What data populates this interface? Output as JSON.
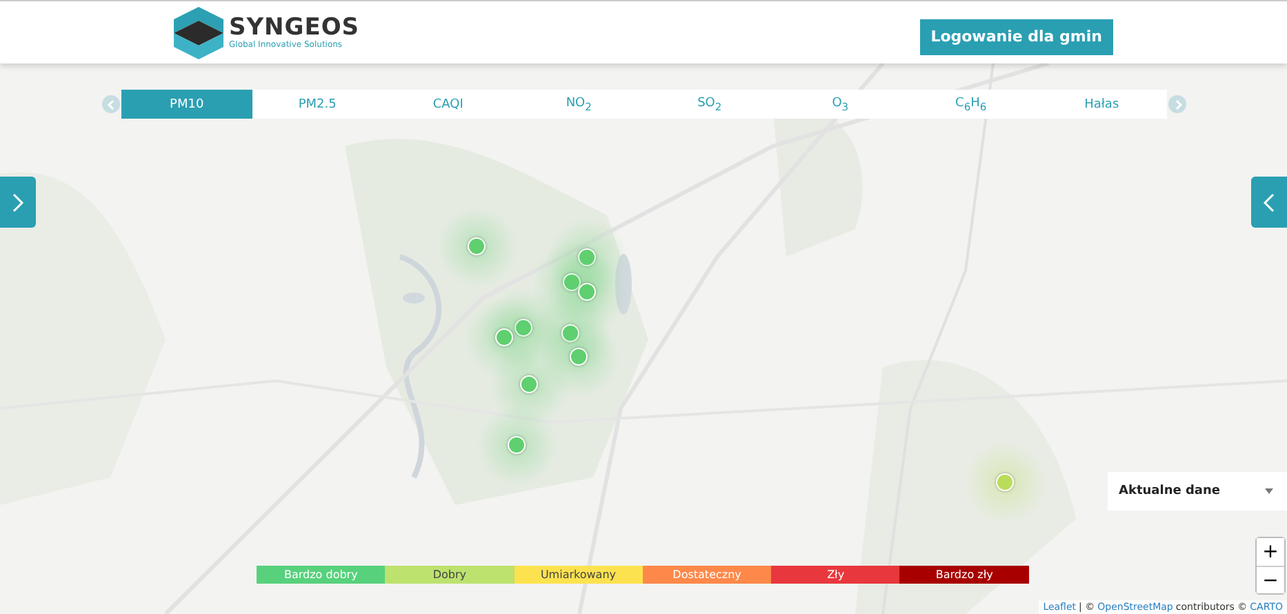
{
  "header": {
    "logo_name": "SYNGEOS",
    "logo_tagline": "Global Innovative Solutions",
    "login_button": "Logowanie dla gmin"
  },
  "tabs": [
    {
      "label": "PM10",
      "selected": true
    },
    {
      "label": "PM2.5",
      "selected": false
    },
    {
      "label": "CAQI",
      "selected": false
    },
    {
      "label": "NO$_{2}$",
      "selected": false
    },
    {
      "label": "SO$_{2}$",
      "selected": false
    },
    {
      "label": "O$_{3}$",
      "selected": false
    },
    {
      "label": "C$_{6}$H$_{6}$",
      "selected": false
    },
    {
      "label": "Hałas",
      "selected": false
    }
  ],
  "stations": [
    {
      "color": "#5fcf6f"
    },
    {
      "color": "#5fcf6f"
    },
    {
      "color": "#5fcf6f"
    },
    {
      "color": "#5fcf6f"
    },
    {
      "color": "#5fcf6f"
    },
    {
      "color": "#5fcf6f"
    },
    {
      "color": "#5fcf6f"
    },
    {
      "color": "#5fcf6f"
    },
    {
      "color": "#5fcf6f"
    },
    {
      "color": "#5fcf6f"
    },
    {
      "color": "#b9dc5a"
    }
  ],
  "data_select": {
    "value": "Aktualne dane"
  },
  "zoom": {
    "in": "+",
    "out": "−"
  },
  "legend": [
    {
      "label": "Bardzo dobry",
      "color": "#57d17c"
    },
    {
      "label": "Dobry",
      "color": "#bde26e"
    },
    {
      "label": "Umiarkowany",
      "color": "#fde24f"
    },
    {
      "label": "Dostateczny",
      "color": "#fe8849"
    },
    {
      "label": "Zły",
      "color": "#e8383d"
    },
    {
      "label": "Bardzo zły",
      "color": "#a80000"
    }
  ],
  "attribution": {
    "leaflet": "Leaflet",
    "sep1": "| ©",
    "osm": "OpenStreetMap",
    "contributors": "contributors ©",
    "carto": "CARTO"
  }
}
